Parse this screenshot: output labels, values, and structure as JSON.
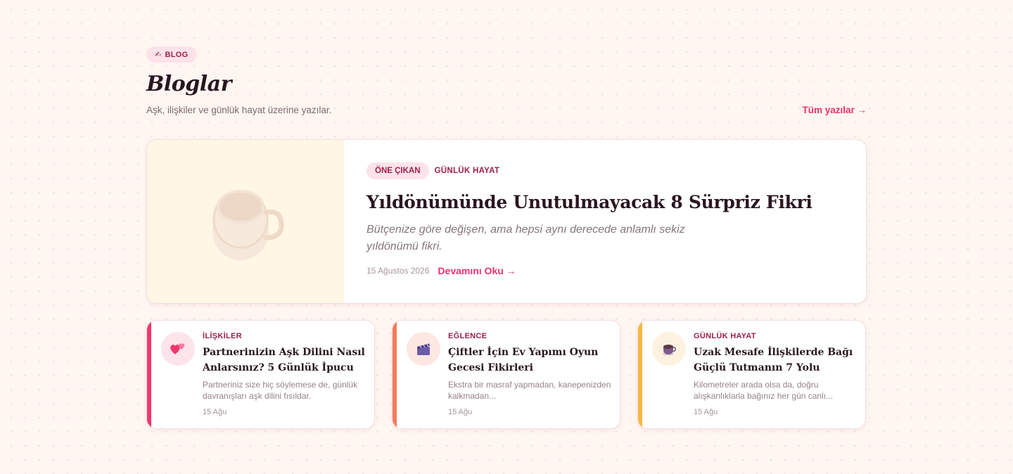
{
  "section": {
    "badge_icon": "✍",
    "badge_label": "BLOG",
    "title": "Bloglar",
    "subtitle": "Aşk, ilişkiler ve günlük hayat üzerine yazılar.",
    "all_link": "Tüm yazılar →"
  },
  "featured": {
    "image_icon": "coffee-cup",
    "tag": "ÖNE ÇIKAN",
    "category": "GÜNLÜK HAYAT",
    "title": "Yıldönümünde Unutulmayacak 8 Sürpriz Fikri",
    "excerpt": "Bütçenize göre değişen, ama hepsi aynı derecede anlamlı sekiz yıldönümü fikri.",
    "date": "15 Ağustos 2026",
    "read_more": "Devamını Oku →"
  },
  "cards": [
    {
      "icon": "two-hearts",
      "category": "İLİŞKİLER",
      "title": "Partnerinizin Aşk Dilini Nasıl Anlarsınız? 5 Günlük İpucu",
      "excerpt": "Partneriniz size hiç söylemese de, günlük davranışları aşk dilini fısıldar.",
      "date": "15 Ağu",
      "accent": "#f0386b",
      "thumb_bg": "#fde3ea"
    },
    {
      "icon": "clapperboard",
      "category": "EĞLENCE",
      "title": "Çiftler İçin Ev Yapımı Oyun Gecesi Fikirleri",
      "excerpt": "Ekstra bir masraf yapmadan, kanepenizden kalkmadan...",
      "date": "15 Ağu",
      "accent": "#f47a5e",
      "thumb_bg": "#fde7e2"
    },
    {
      "icon": "coffee-cup",
      "category": "GÜNLÜK HAYAT",
      "title": "Uzak Mesafe İlişkilerde Bağı Güçlü Tutmanın 7 Yolu",
      "excerpt": "Kilometreler arada olsa da, doğru alışkanlıklarla bağınız her gün canlı...",
      "date": "15 Ağu",
      "accent": "#f5b942",
      "thumb_bg": "#fdf2e0"
    }
  ]
}
